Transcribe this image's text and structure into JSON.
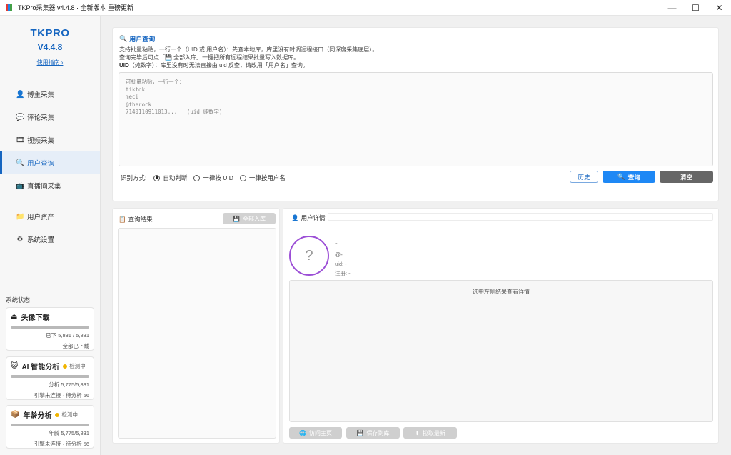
{
  "window": {
    "title": "TKPro采集器 v4.4.8 · 全新版本 重磅更新",
    "minimize": "—",
    "maximize": "☐",
    "close": "✕"
  },
  "sidebar": {
    "brand": "TKPRO",
    "version": "V4.4.8",
    "guide": "使用指南 ›",
    "items": [
      {
        "label": "博主采集",
        "icon": "user-icon"
      },
      {
        "label": "评论采集",
        "icon": "comment-icon"
      },
      {
        "label": "视频采集",
        "icon": "video-icon"
      },
      {
        "label": "用户查询",
        "icon": "search-icon"
      },
      {
        "label": "直播间采集",
        "icon": "live-icon"
      }
    ],
    "items2": [
      {
        "label": "用户资产",
        "icon": "folder-icon"
      },
      {
        "label": "系统设置",
        "icon": "gear-icon"
      }
    ],
    "status_label": "系统状态",
    "cards": [
      {
        "title": "头像下载",
        "icon": "download-icon",
        "badge": "",
        "line1": "已下 5,831 / 5,831",
        "line2": "全部已下载",
        "progress": 1.0
      },
      {
        "title": "AI 智能分析",
        "icon": "robot-icon",
        "badge": "检测中",
        "line1": "分析 5,775/5,831",
        "line2": "引擎未连接 · 待分析 56",
        "progress": 0.99
      },
      {
        "title": "年龄分析",
        "icon": "box-icon",
        "badge": "检测中",
        "line1": "年龄 5,775/5,831",
        "line2": "引擎未连接 · 待分析 56",
        "progress": 0.99
      }
    ]
  },
  "query": {
    "title": "用户查询",
    "desc1": "支持批量粘贴，一行一个（UID 或 用户名）：先查本地库，库里没有时调远程接口（同深度采集底层）。",
    "desc2": "查询完毕后可点「💾 全部入库」一键把所有远程结果批量写入数据库。",
    "desc3_bold": "UID",
    "desc3": "（纯数字）：库里没有时无法直接由 uid 反查，请改用「用户名」查询。",
    "placeholder": "可批量粘贴，一行一个：\ntiktok\nmeci\n@therock\n7140110911013...   (uid 纯数字)",
    "mode_label": "识别方式:",
    "modes": [
      "自动判断",
      "一律按 UID",
      "一律按用户名"
    ],
    "selected_mode": 0,
    "history": "历史",
    "search": "查询",
    "clear": "清空"
  },
  "results": {
    "title": "查询结果",
    "import": "全部入库"
  },
  "detail": {
    "title": "用户详情",
    "avatar_placeholder": "?",
    "name": "-",
    "handle": "@-",
    "uid": "uid: -",
    "reg": "注册: -",
    "hint": "选中左侧结果查看详情",
    "btn_visit": "访问主页",
    "btn_save": "保存到库",
    "btn_refresh": "拉取最新"
  },
  "colors": {
    "accent": "#1565c0",
    "primary_button": "#1e88f5",
    "avatar_ring": "#9c4fd6",
    "status_dot": "#f0b400"
  }
}
